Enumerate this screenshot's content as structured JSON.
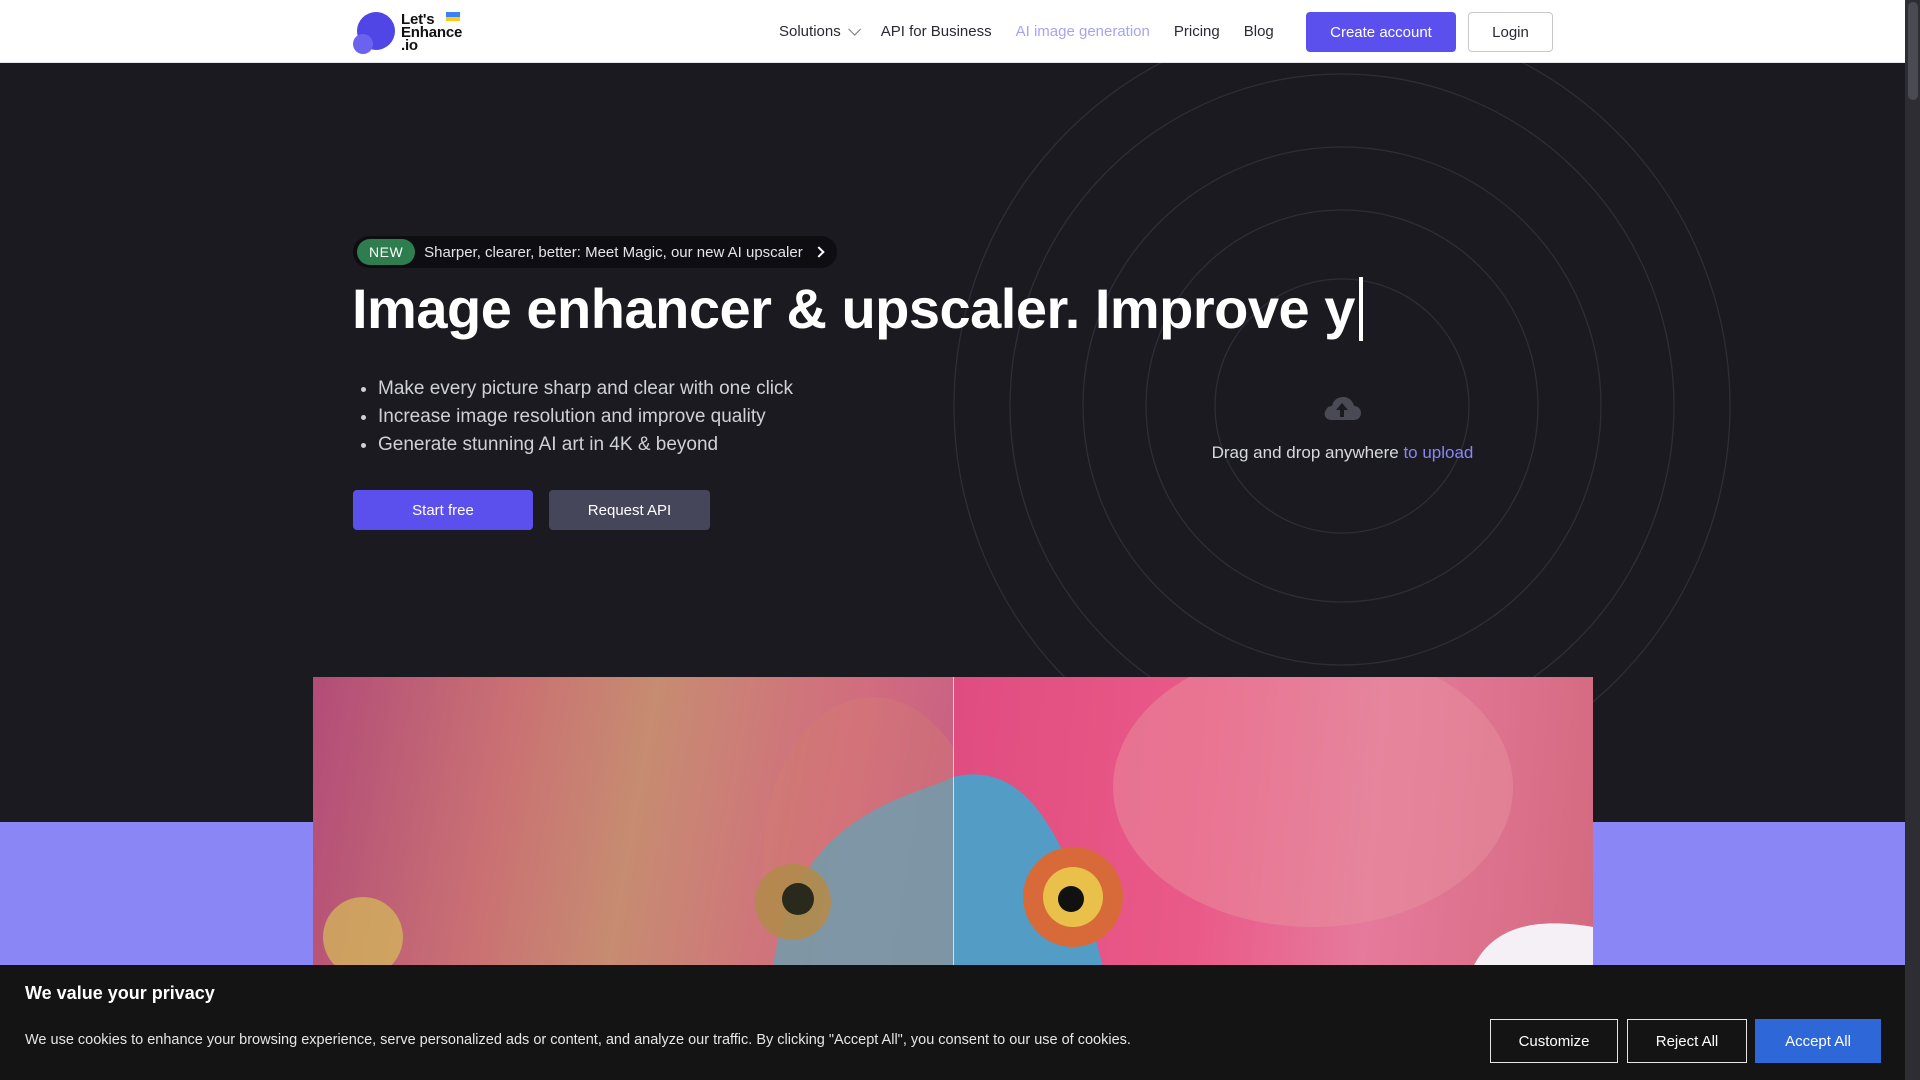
{
  "header": {
    "logo_lines": [
      "Let's",
      "Enhance",
      ".io"
    ],
    "nav": [
      {
        "label": "Solutions",
        "has_dropdown": true
      },
      {
        "label": "API for Business"
      },
      {
        "label": "AI image generation",
        "active": true
      },
      {
        "label": "Pricing"
      },
      {
        "label": "Blog"
      }
    ],
    "create_account_label": "Create account",
    "login_label": "Login"
  },
  "hero": {
    "badge_tag": "NEW",
    "badge_text": "Sharper, clearer, better: Meet Magic, our new AI upscaler",
    "headline": "Image enhancer & upscaler.  Improve y",
    "bullets": [
      "Make every picture sharp and clear with one click",
      "Increase image resolution and improve quality",
      "Generate stunning AI art in 4K & beyond"
    ],
    "start_label": "Start free",
    "api_label": "Request API",
    "upload_text": "Drag and drop anywhere ",
    "upload_link": "to upload"
  },
  "cookie": {
    "title": "We value your privacy",
    "text": "We use cookies to enhance your browsing experience, serve personalized ads or content, and analyze our traffic. By clicking \"Accept All\", you consent to our use of cookies.",
    "customize_label": "Customize",
    "reject_label": "Reject All",
    "accept_label": "Accept All"
  },
  "colors": {
    "brand": "#5b50ee",
    "hero_bg": "#1a1a20",
    "band": "#8b86f5",
    "accept": "#2d67d8"
  }
}
